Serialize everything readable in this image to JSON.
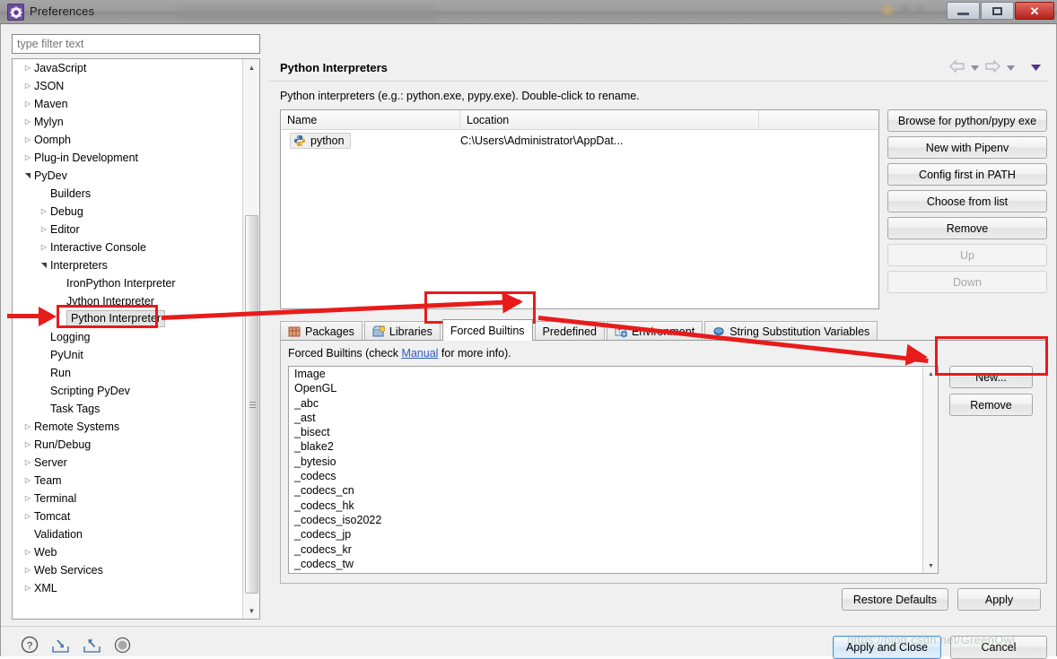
{
  "window": {
    "title": "Preferences",
    "icon": "gear-icon",
    "controls": {
      "minimize": "Minimize",
      "maximize": "Maximize",
      "close": "✕"
    }
  },
  "filter": {
    "placeholder": "type filter text",
    "value": ""
  },
  "tree": {
    "items": [
      {
        "label": "JavaScript",
        "indent": 0,
        "twisty": "collapsed"
      },
      {
        "label": "JSON",
        "indent": 0,
        "twisty": "collapsed"
      },
      {
        "label": "Maven",
        "indent": 0,
        "twisty": "collapsed"
      },
      {
        "label": "Mylyn",
        "indent": 0,
        "twisty": "collapsed"
      },
      {
        "label": "Oomph",
        "indent": 0,
        "twisty": "collapsed"
      },
      {
        "label": "Plug-in Development",
        "indent": 0,
        "twisty": "collapsed"
      },
      {
        "label": "PyDev",
        "indent": 0,
        "twisty": "expanded"
      },
      {
        "label": "Builders",
        "indent": 1,
        "twisty": "none"
      },
      {
        "label": "Debug",
        "indent": 1,
        "twisty": "collapsed"
      },
      {
        "label": "Editor",
        "indent": 1,
        "twisty": "collapsed"
      },
      {
        "label": "Interactive Console",
        "indent": 1,
        "twisty": "collapsed"
      },
      {
        "label": "Interpreters",
        "indent": 1,
        "twisty": "expanded"
      },
      {
        "label": "IronPython Interpreter",
        "indent": 2,
        "twisty": "none"
      },
      {
        "label": "Jython Interpreter",
        "indent": 2,
        "twisty": "none"
      },
      {
        "label": "Python Interpreter",
        "indent": 2,
        "twisty": "none",
        "selected": true
      },
      {
        "label": "Logging",
        "indent": 1,
        "twisty": "none"
      },
      {
        "label": "PyUnit",
        "indent": 1,
        "twisty": "none"
      },
      {
        "label": "Run",
        "indent": 1,
        "twisty": "none"
      },
      {
        "label": "Scripting PyDev",
        "indent": 1,
        "twisty": "none"
      },
      {
        "label": "Task Tags",
        "indent": 1,
        "twisty": "none"
      },
      {
        "label": "Remote Systems",
        "indent": 0,
        "twisty": "collapsed"
      },
      {
        "label": "Run/Debug",
        "indent": 0,
        "twisty": "collapsed"
      },
      {
        "label": "Server",
        "indent": 0,
        "twisty": "collapsed"
      },
      {
        "label": "Team",
        "indent": 0,
        "twisty": "collapsed"
      },
      {
        "label": "Terminal",
        "indent": 0,
        "twisty": "collapsed"
      },
      {
        "label": "Tomcat",
        "indent": 0,
        "twisty": "collapsed"
      },
      {
        "label": "Validation",
        "indent": 0,
        "twisty": "none"
      },
      {
        "label": "Web",
        "indent": 0,
        "twisty": "collapsed"
      },
      {
        "label": "Web Services",
        "indent": 0,
        "twisty": "collapsed"
      },
      {
        "label": "XML",
        "indent": 0,
        "twisty": "collapsed"
      }
    ]
  },
  "page": {
    "title": "Python Interpreters",
    "description": "Python interpreters (e.g.: python.exe, pypy.exe).   Double-click to rename.",
    "nav": {
      "back": "back-arrow",
      "back_menu": "chevron-down",
      "forward": "forward-arrow",
      "forward_menu": "chevron-down",
      "view_menu": "chevron-down"
    }
  },
  "interpreters_table": {
    "columns": [
      "Name",
      "Location",
      ""
    ],
    "rows": [
      {
        "name": "python",
        "location": "C:\\Users\\Administrator\\AppDat...",
        "icon": "python-icon"
      }
    ]
  },
  "side_buttons": [
    {
      "label": "Browse for python/pypy exe",
      "enabled": true
    },
    {
      "label": "New with Pipenv",
      "enabled": true
    },
    {
      "label": "Config first in PATH",
      "enabled": true
    },
    {
      "label": "Choose from list",
      "enabled": true
    },
    {
      "label": "Remove",
      "enabled": true
    },
    {
      "label": "Up",
      "enabled": false
    },
    {
      "label": "Down",
      "enabled": false
    }
  ],
  "tabs": [
    {
      "label": "Packages",
      "icon": "packages-icon",
      "active": false
    },
    {
      "label": "Libraries",
      "icon": "libraries-icon",
      "active": false
    },
    {
      "label": "Forced Builtins",
      "icon": "",
      "active": true
    },
    {
      "label": "Predefined",
      "icon": "",
      "active": false
    },
    {
      "label": "Environment",
      "icon": "environment-icon",
      "active": false
    },
    {
      "label": "String Substitution Variables",
      "icon": "variables-icon",
      "active": false
    }
  ],
  "forced_builtins": {
    "label_before": "Forced Builtins (check ",
    "link": "Manual",
    "label_after": " for more info).",
    "items": [
      "Image",
      "OpenGL",
      "_abc",
      "_ast",
      "_bisect",
      "_blake2",
      "_bytesio",
      "_codecs",
      "_codecs_cn",
      "_codecs_hk",
      "_codecs_iso2022",
      "_codecs_jp",
      "_codecs_kr",
      "_codecs_tw"
    ],
    "buttons": [
      {
        "label": "New..."
      },
      {
        "label": "Remove"
      }
    ]
  },
  "page_buttons": [
    {
      "label": "Restore Defaults"
    },
    {
      "label": "Apply"
    }
  ],
  "footer": {
    "icons": [
      {
        "name": "help-icon",
        "glyph": "?"
      },
      {
        "name": "import-icon",
        "glyph": "import"
      },
      {
        "name": "export-icon",
        "glyph": "export"
      },
      {
        "name": "record-icon",
        "glyph": "record"
      }
    ],
    "buttons": [
      {
        "label": "Apply and Close",
        "primary": true
      },
      {
        "label": "Cancel",
        "primary": false
      }
    ]
  },
  "watermark": "https://blog.csdn.net/GreenOwl",
  "annotations": {
    "accent_color": "#e81b1b",
    "highlight_boxes": [
      "Python Interpreter",
      "Forced Builtins",
      "New..."
    ],
    "arrows": [
      "pointer to Python Interpreter tree node",
      "Python Interpreter to Forced Builtins tab",
      "Forced Builtins tab to New... button"
    ]
  }
}
